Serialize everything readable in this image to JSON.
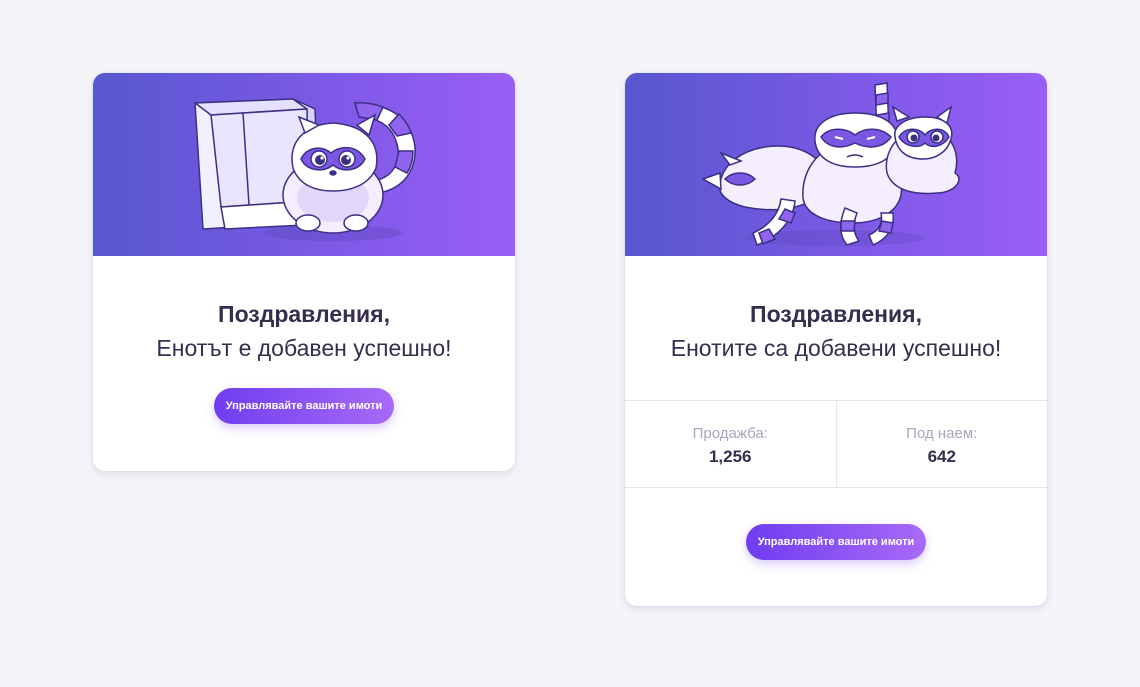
{
  "cards": [
    {
      "illustration": "raccoon-with-box",
      "heading": "Поздравления,",
      "message": "Енотът е добавен успешно!",
      "button_label": "Управлявайте вашите имоти"
    },
    {
      "illustration": "three-raccoons-lying",
      "heading": "Поздравления,",
      "message": "Енотите са добавени успешно!",
      "stats": [
        {
          "label": "Продажба:",
          "value": "1,256"
        },
        {
          "label": "Под наем:",
          "value": "642"
        }
      ],
      "button_label": "Управлявайте вашите имоти"
    }
  ],
  "colors": {
    "page_background": "#f5f4f9",
    "hero_gradient_start": "#5757cf",
    "hero_gradient_end": "#9a5ef6",
    "button_gradient_start": "#6f3df0",
    "button_gradient_end": "#a86af7",
    "text_dark": "#322f4f",
    "text_muted": "#a9a6bd"
  }
}
